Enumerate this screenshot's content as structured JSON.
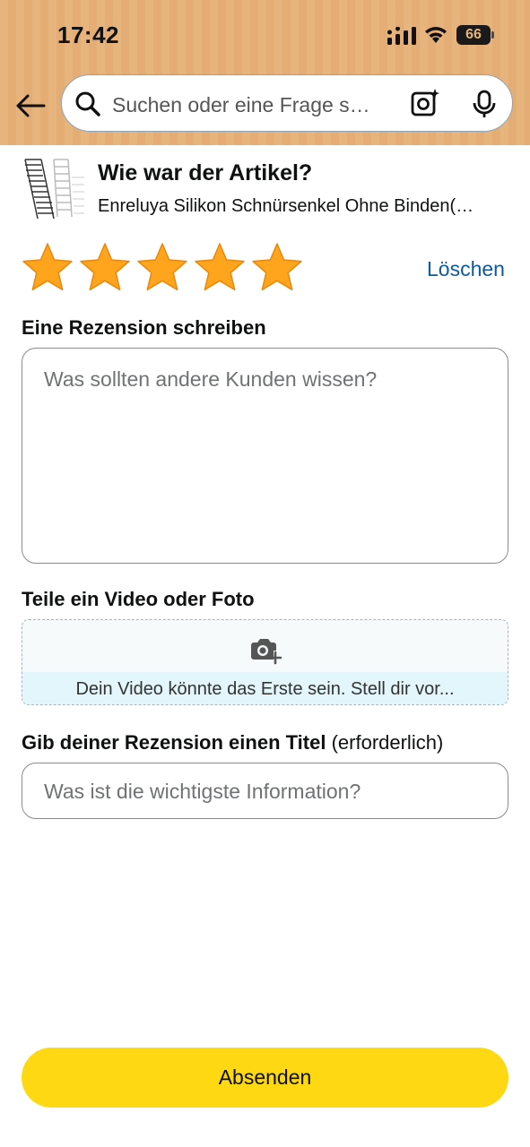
{
  "status_bar": {
    "time": "17:42",
    "battery_level": "66"
  },
  "search": {
    "placeholder": "Suchen oder eine Frage s…",
    "icons": [
      "back-arrow-icon",
      "search-icon",
      "camera-search-icon",
      "microphone-icon"
    ]
  },
  "product": {
    "heading": "Wie war der Artikel?",
    "name": "Enreluya Silikon Schnürsenkel Ohne Binden(…"
  },
  "rating": {
    "stars_selected": 5,
    "stars_total": 5,
    "star_color": "#ffa41c",
    "clear_label": "Löschen"
  },
  "review": {
    "label": "Eine Rezension schreiben",
    "placeholder": "Was sollten andere Kunden wissen?"
  },
  "media": {
    "label": "Teile ein Video oder Foto",
    "banner_text": "Dein Video könnte das Erste sein. Stell dir vor..."
  },
  "title_field": {
    "label": "Gib deiner Rezension einen Titel",
    "required_note": "(erforderlich)",
    "placeholder": "Was ist die wichtigste Information?"
  },
  "submit": {
    "label": "Absenden",
    "color": "#ffd814"
  },
  "colors": {
    "header_bg": "#e8b47d",
    "link": "#0e5a9c"
  }
}
